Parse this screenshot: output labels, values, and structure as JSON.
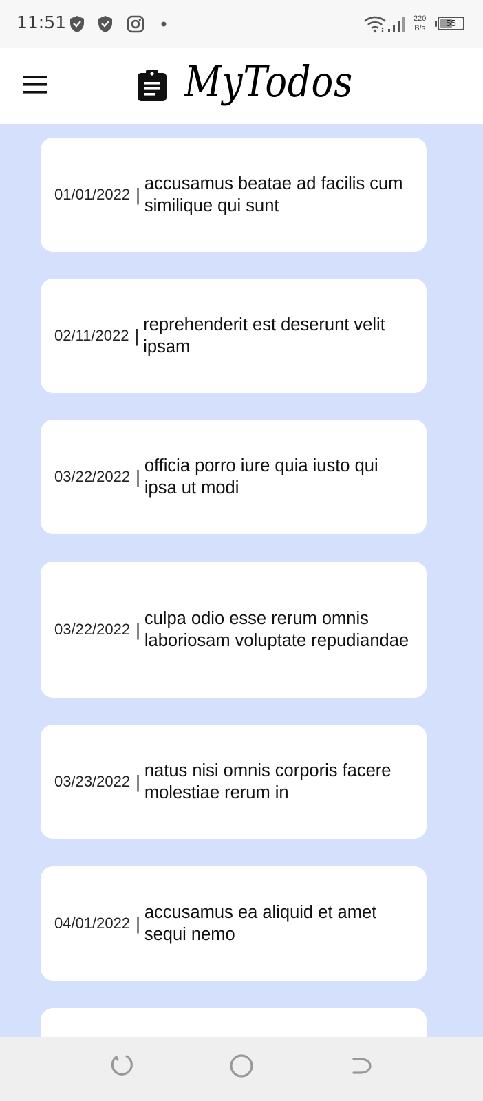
{
  "status_bar": {
    "time": "11:51",
    "icons": [
      "shield-icon",
      "shield-icon",
      "instagram-icon",
      "dot-icon",
      "wifi-icon",
      "signal-icon"
    ],
    "net_speed_value": "220",
    "net_speed_unit": "B/s",
    "battery_level": "55",
    "battery_fraction": 0.55
  },
  "header": {
    "title": "MyTodos",
    "menu_icon": "hamburger-icon",
    "logo_icon": "clipboard-icon"
  },
  "todos": [
    {
      "date": "01/01/2022",
      "separator": "|",
      "text": "accusamus beatae ad facilis cum similique qui sunt"
    },
    {
      "date": "02/11/2022",
      "separator": "|",
      "text": "reprehenderit est deserunt velit ipsam"
    },
    {
      "date": "03/22/2022",
      "separator": "|",
      "text": "officia porro iure quia iusto qui ipsa ut modi"
    },
    {
      "date": "03/22/2022",
      "separator": "|",
      "text": "culpa odio esse rerum omnis laboriosam voluptate repudiandae"
    },
    {
      "date": "03/23/2022",
      "separator": "|",
      "text": "natus nisi omnis corporis facere molestiae rerum in"
    },
    {
      "date": "04/01/2022",
      "separator": "|",
      "text": "accusamus ea aliquid et amet sequi nemo"
    },
    {
      "date": "",
      "separator": "",
      "text": ""
    }
  ],
  "nav_bar": {
    "buttons": [
      "recents-icon",
      "home-icon",
      "back-icon"
    ]
  },
  "colors": {
    "list_background": "#d5e0fd",
    "card_background": "#ffffff",
    "header_background": "#ffffff",
    "status_bar_background": "#f7f7f7",
    "nav_bar_background": "#efefef"
  }
}
